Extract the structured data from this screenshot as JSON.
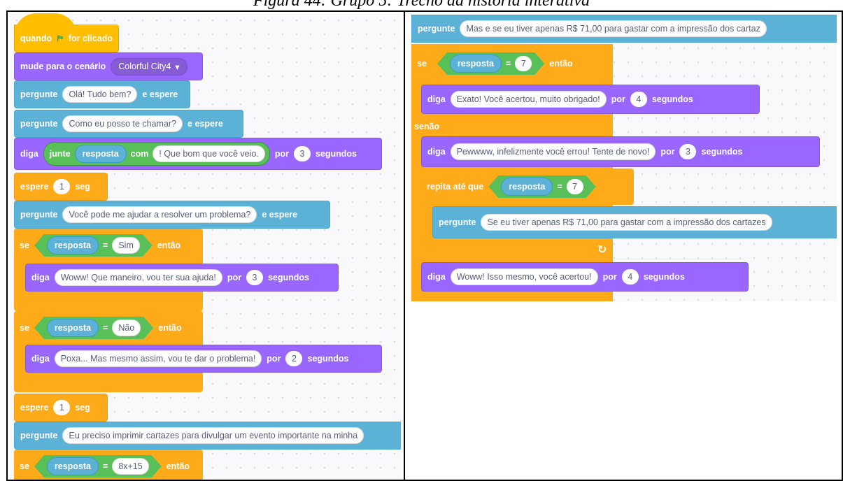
{
  "caption": "Figura 44: Grupo 5: Trecho da história interativa",
  "left": {
    "hat": {
      "quando": "quando",
      "suffix": "for clicado",
      "icon": "green-flag-icon"
    },
    "backdrop": {
      "label": "mude para o cenário",
      "value": "Colorful City4"
    },
    "ask1": {
      "label": "pergunte",
      "text": "Olá! Tudo bem?",
      "suffix": "e espere"
    },
    "ask2": {
      "label": "pergunte",
      "text": "Como eu posso te chamar?",
      "suffix": "e espere"
    },
    "say1": {
      "label": "diga",
      "join": "junte",
      "reporter": "resposta",
      "with": "com",
      "text": "! Que bom que você veio.",
      "for": "por",
      "secs": "3",
      "unit": "segundos"
    },
    "wait1": {
      "label": "espere",
      "value": "1",
      "unit": "seg"
    },
    "ask3": {
      "label": "pergunte",
      "text": "Você pode me ajudar a resolver um problema?",
      "suffix": "e espere"
    },
    "if1": {
      "se": "se",
      "reporter": "resposta",
      "eq": "=",
      "value": "Sim",
      "then": "então"
    },
    "say2": {
      "label": "diga",
      "text": "Woww! Que maneiro, vou ter sua ajuda!",
      "for": "por",
      "secs": "3",
      "unit": "segundos"
    },
    "if2": {
      "se": "se",
      "reporter": "resposta",
      "eq": "=",
      "value": "Não",
      "then": "então"
    },
    "say3": {
      "label": "diga",
      "text": "Poxa... Mas mesmo assim, vou te dar o problema!",
      "for": "por",
      "secs": "2",
      "unit": "segundos"
    },
    "wait2": {
      "label": "espere",
      "value": "1",
      "unit": "seg"
    },
    "ask4": {
      "label": "pergunte",
      "text": "Eu preciso imprimir cartazes para divulgar um evento importante na minha"
    },
    "if3": {
      "se": "se",
      "reporter": "resposta",
      "eq": "=",
      "value": "8x+15",
      "then": "então"
    }
  },
  "right": {
    "ask1": {
      "label": "pergunte",
      "text": "Mas e se eu tiver apenas R$ 71,00 para gastar com a impressão dos cartaz"
    },
    "if1": {
      "se": "se",
      "reporter": "resposta",
      "eq": "=",
      "value": "7",
      "then": "então",
      "else": "senão"
    },
    "say1": {
      "label": "diga",
      "text": "Exato! Você acertou, muito obrigado!",
      "for": "por",
      "secs": "4",
      "unit": "segundos"
    },
    "say2": {
      "label": "diga",
      "text": "Pewwww, infelizmente você errou! Tente de novo!",
      "for": "por",
      "secs": "3",
      "unit": "segundos"
    },
    "repeat": {
      "label": "repita até que",
      "reporter": "resposta",
      "eq": "=",
      "value": "7",
      "icon": "loop-arrow-icon"
    },
    "ask2": {
      "label": "pergunte",
      "text": "Se eu tiver apenas R$ 71,00 para gastar com a impressão dos cartazes"
    },
    "say3": {
      "label": "diga",
      "text": "Woww! Isso mesmo, você acertou!",
      "for": "por",
      "secs": "4",
      "unit": "segundos"
    }
  }
}
